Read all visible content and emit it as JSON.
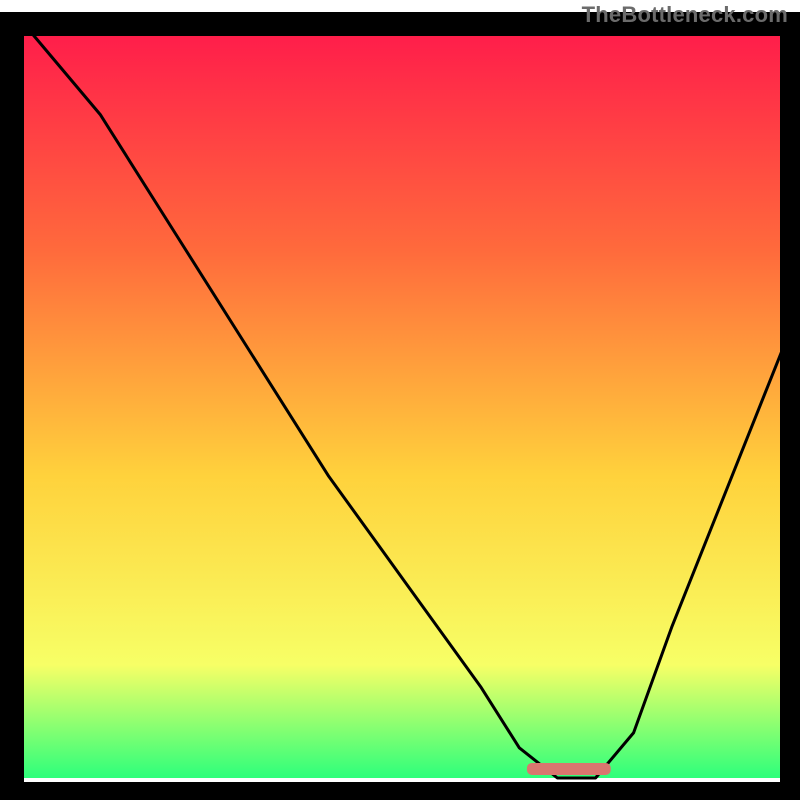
{
  "watermark": "TheBottleneck.com",
  "chart_data": {
    "type": "line",
    "title": "",
    "xlabel": "",
    "ylabel": "",
    "xlim": [
      0,
      100
    ],
    "ylim": [
      0,
      100
    ],
    "background_gradient": {
      "top": "#ff1a4b",
      "mid_upper": "#ff6a3c",
      "mid": "#ffd23c",
      "mid_lower": "#f7ff66",
      "bottom": "#2dff7b"
    },
    "series": [
      {
        "name": "bottleneck-curve",
        "x": [
          0,
          10,
          20,
          30,
          40,
          50,
          60,
          65,
          70,
          75,
          80,
          85,
          100
        ],
        "y": [
          100,
          88,
          72,
          56,
          40,
          26,
          12,
          4,
          0,
          0,
          6,
          20,
          58
        ]
      }
    ],
    "marker": {
      "name": "optimal-range",
      "x_start": 66,
      "x_end": 77,
      "y": 1.2,
      "color": "#d9766f"
    },
    "frame_color": "#000000"
  }
}
